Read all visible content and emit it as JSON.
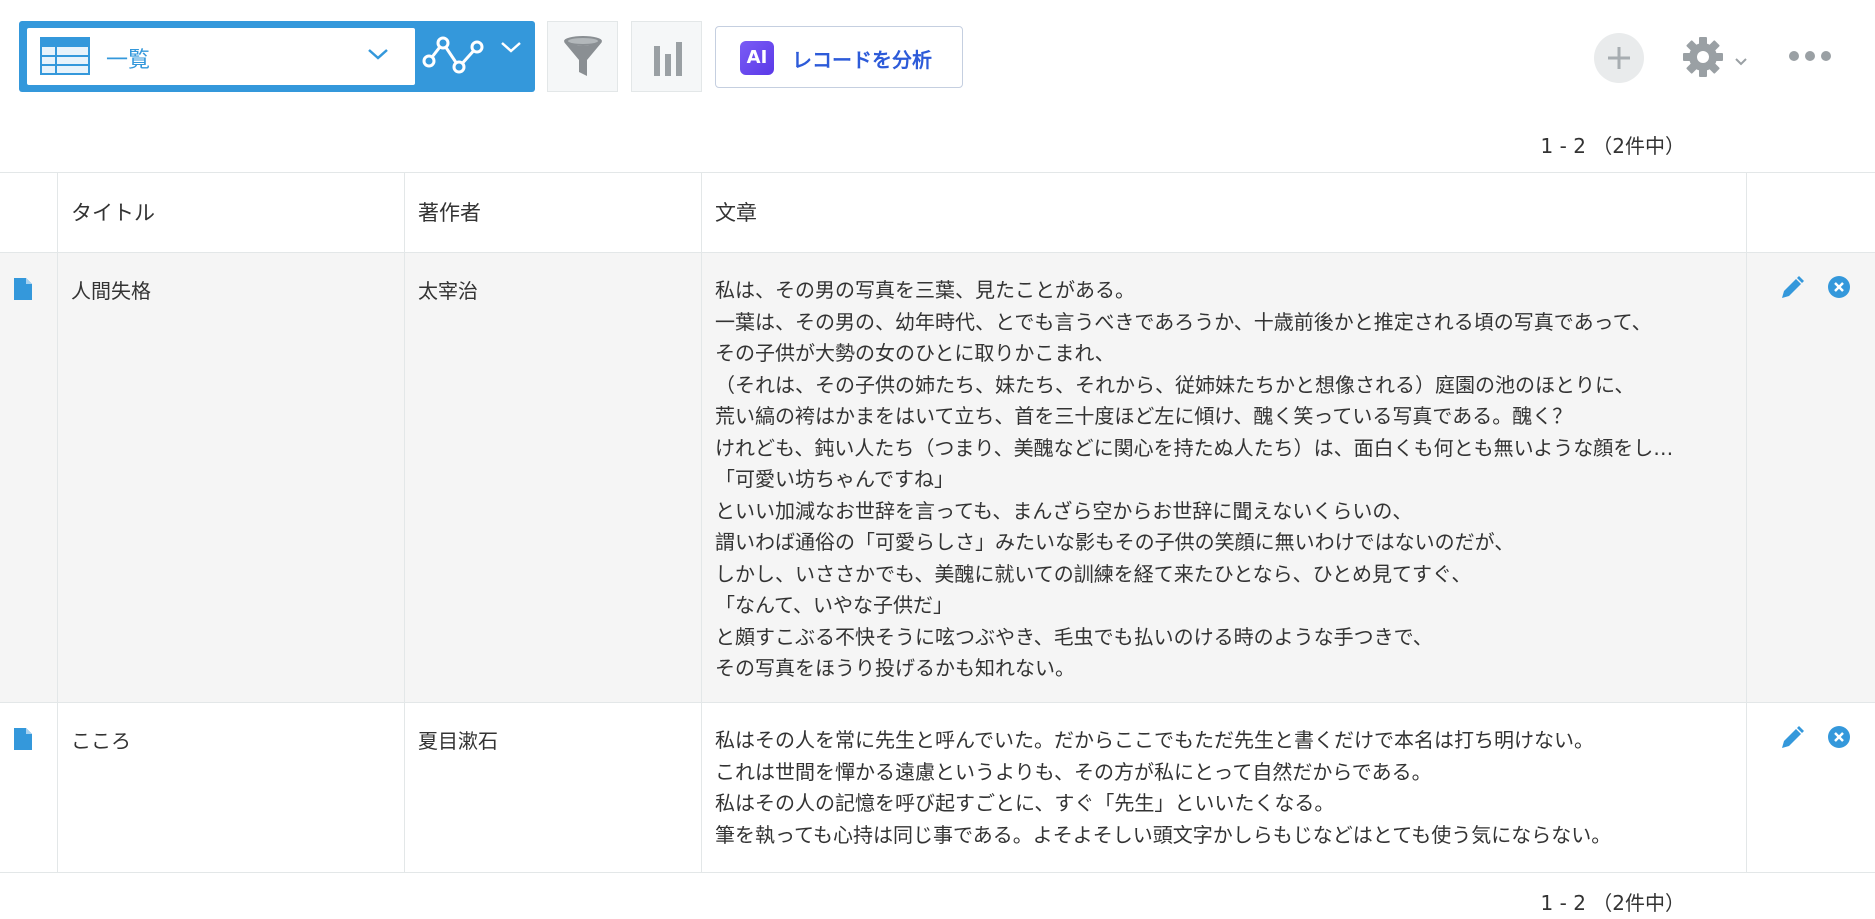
{
  "toolbar": {
    "view_label": "一覧",
    "ai_badge": "AI",
    "ai_label": "レコードを分析"
  },
  "pager": {
    "top": "1 - 2 （2件中）",
    "bottom": "1 - 2 （2件中）"
  },
  "table": {
    "headers": [
      "タイトル",
      "著作者",
      "文章"
    ],
    "rows": [
      {
        "title": "人間失格",
        "author": "太宰治",
        "lines": [
          "私は、その男の写真を三葉、見たことがある。",
          "一葉は、その男の、幼年時代、とでも言うべきであろうか、十歳前後かと推定される頃の写真であって、",
          "その子供が大勢の女のひとに取りかこまれ、",
          "（それは、その子供の姉たち、妹たち、それから、従姉妹たちかと想像される）庭園の池のほとりに、",
          "荒い縞の袴はかまをはいて立ち、首を三十度ほど左に傾け、醜く笑っている写真である。醜く？",
          "けれども、鈍い人たち（つまり、美醜などに関心を持たぬ人たち）は、面白くも何とも無いような顔をし…",
          "「可愛い坊ちゃんですね」",
          "といい加減なお世辞を言っても、まんざら空からお世辞に聞えないくらいの、",
          "謂いわば通俗の「可愛らしさ」みたいな影もその子供の笑顔に無いわけではないのだが、",
          "しかし、いささかでも、美醜に就いての訓練を経て来たひとなら、ひとめ見てすぐ、",
          "「なんて、いやな子供だ」",
          "と頗すこぶる不快そうに呟つぶやき、毛虫でも払いのける時のような手つきで、",
          "その写真をほうり投げるかも知れない。"
        ]
      },
      {
        "title": "こころ",
        "author": "夏目漱石",
        "lines": [
          "私はその人を常に先生と呼んでいた。だからここでもただ先生と書くだけで本名は打ち明けない。",
          "これは世間を憚かる遠慮というよりも、その方が私にとって自然だからである。",
          "私はその人の記憶を呼び起すごとに、すぐ「先生」といいたくなる。",
          "筆を執っても心持は同じ事である。よそよそしい頭文字かしらもじなどはとても使う気にならない。"
        ]
      }
    ]
  },
  "colors": {
    "accent": "#3498db",
    "ai_purple": "#6a4cf0",
    "row_alt": "#f5f5f5",
    "border": "#e3e7e8"
  },
  "icons": [
    "table-view-icon",
    "chevron-down-icon",
    "graph-icon",
    "filter-icon",
    "bar-graph-icon",
    "plus-icon",
    "gear-icon",
    "more-icon",
    "document-icon",
    "edit-icon",
    "delete-icon"
  ]
}
